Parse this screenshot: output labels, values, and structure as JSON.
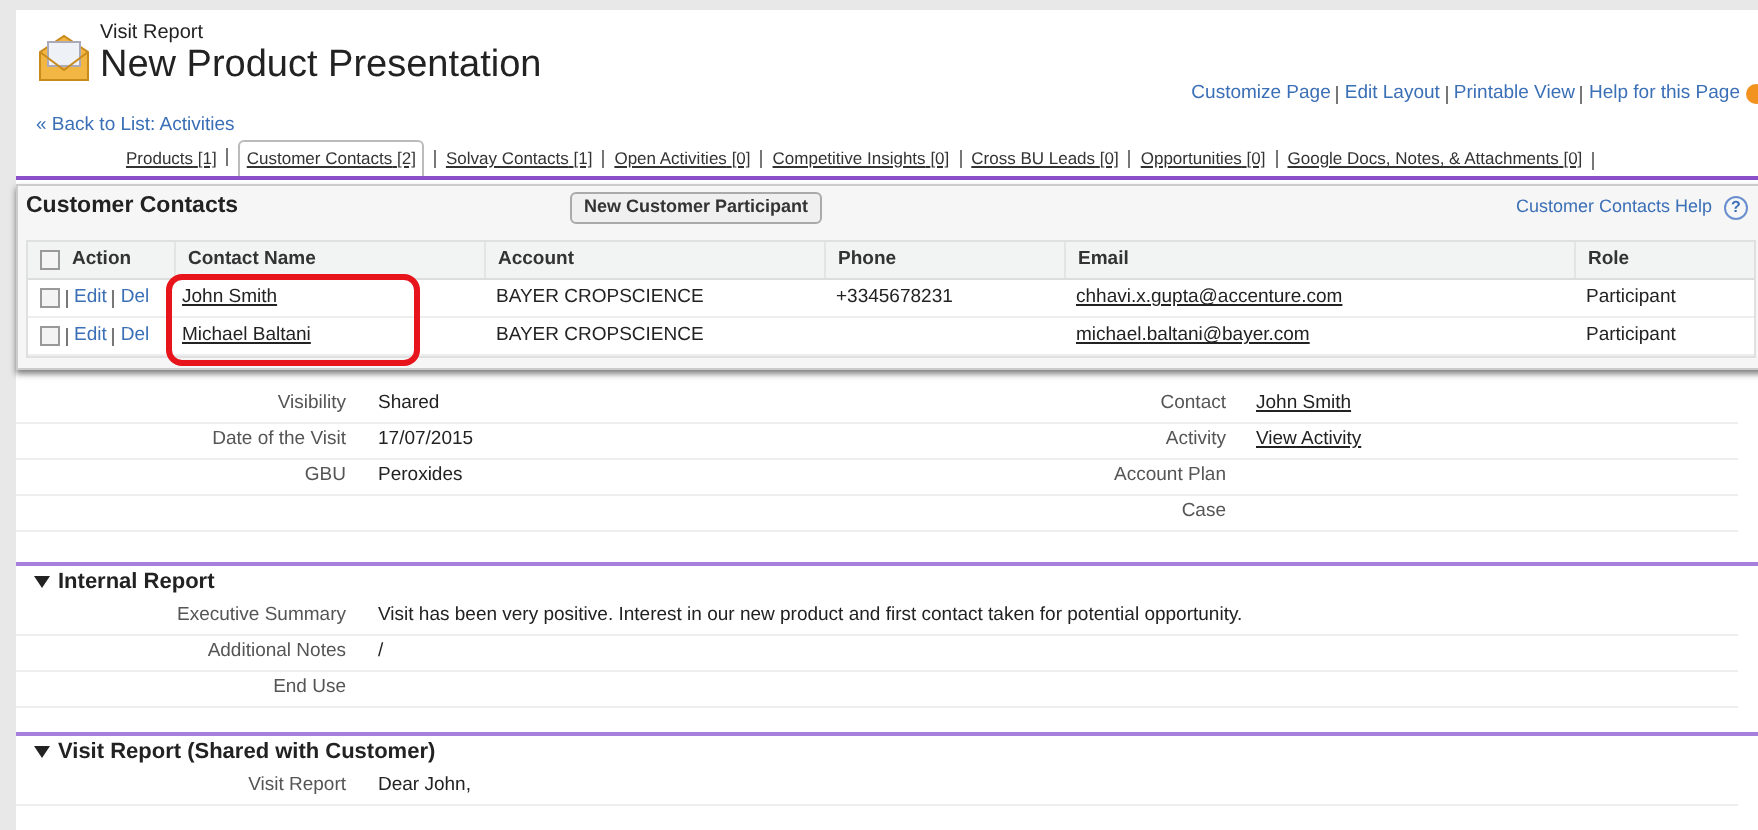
{
  "header": {
    "object_type": "Visit Report",
    "title": "New Product Presentation"
  },
  "top_links": [
    "Customize Page",
    "Edit Layout",
    "Printable View",
    "Help for this Page"
  ],
  "back_link": "« Back to List: Activities",
  "related_tabs": [
    {
      "label": "Products",
      "count": "[1]",
      "selected": false
    },
    {
      "label": "Customer Contacts",
      "count": "[2]",
      "selected": true
    },
    {
      "label": "Solvay Contacts",
      "count": "[1]",
      "selected": false
    },
    {
      "label": "Open Activities",
      "count": "[0]",
      "selected": false
    },
    {
      "label": "Competitive Insights",
      "count": "[0]",
      "selected": false
    },
    {
      "label": "Cross BU Leads",
      "count": "[0]",
      "selected": false
    },
    {
      "label": "Opportunities",
      "count": "[0]",
      "selected": false
    },
    {
      "label": "Google Docs, Notes, & Attachments",
      "count": "[0]",
      "selected": false
    }
  ],
  "popup": {
    "title": "Customer Contacts",
    "button": "New Customer Participant",
    "help_link": "Customer Contacts Help",
    "help_icon": "?",
    "all_checked": false,
    "columns": [
      "Action",
      "Contact Name",
      "Account",
      "Phone",
      "Email",
      "Role"
    ],
    "rows": [
      {
        "checked": false,
        "actions": [
          "Edit",
          "Del"
        ],
        "contact": "John Smith",
        "account": "BAYER CROPSCIENCE",
        "phone": "+3345678231",
        "email": "chhavi.x.gupta@accenture.com",
        "role": "Participant"
      },
      {
        "checked": false,
        "actions": [
          "Edit",
          "Del"
        ],
        "contact": "Michael Baltani",
        "account": "BAYER CROPSCIENCE",
        "email": "michael.baltani@bayer.com",
        "role": "Participant"
      }
    ]
  },
  "detail_rows": [
    {
      "left_label": "Visibility",
      "left_value": "Shared",
      "right_label": "Contact",
      "right_value": "John Smith"
    },
    {
      "left_label": "Date of the Visit",
      "left_value": "17/07/2015",
      "right_label": "Activity",
      "right_value": "View Activity"
    },
    {
      "left_label": "GBU",
      "left_value": "Peroxides",
      "right_label": "Account Plan"
    },
    {
      "right_label": "Case"
    }
  ],
  "sections": [
    {
      "title": "Internal Report",
      "expanded": true,
      "rows": [
        {
          "label": "Executive Summary",
          "value": "Visit has been very positive. Interest in our new product and first contact taken for potential opportunity."
        },
        {
          "label": "Additional Notes",
          "value": "/"
        },
        {
          "label": "End Use"
        }
      ]
    },
    {
      "title": "Visit Report (Shared with Customer)",
      "expanded": true,
      "rows": [
        {
          "label": "Visit Report",
          "value": "Dear John,"
        }
      ]
    }
  ]
}
